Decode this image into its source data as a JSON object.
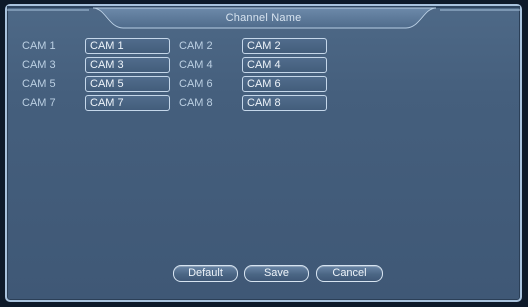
{
  "dialog": {
    "title": "Channel Name"
  },
  "channels": [
    {
      "label": "CAM 1",
      "value": "CAM 1"
    },
    {
      "label": "CAM 2",
      "value": "CAM 2"
    },
    {
      "label": "CAM 3",
      "value": "CAM 3"
    },
    {
      "label": "CAM 4",
      "value": "CAM 4"
    },
    {
      "label": "CAM 5",
      "value": "CAM 5"
    },
    {
      "label": "CAM 6",
      "value": "CAM 6"
    },
    {
      "label": "CAM 7",
      "value": "CAM 7"
    },
    {
      "label": "CAM 8",
      "value": "CAM 8"
    }
  ],
  "buttons": {
    "default_label": "Default",
    "save_label": "Save",
    "cancel_label": "Cancel"
  },
  "colors": {
    "panel": "#455f7d",
    "border": "#a9c3de",
    "title_tab": "#587595",
    "text": "#bcd0e3"
  }
}
